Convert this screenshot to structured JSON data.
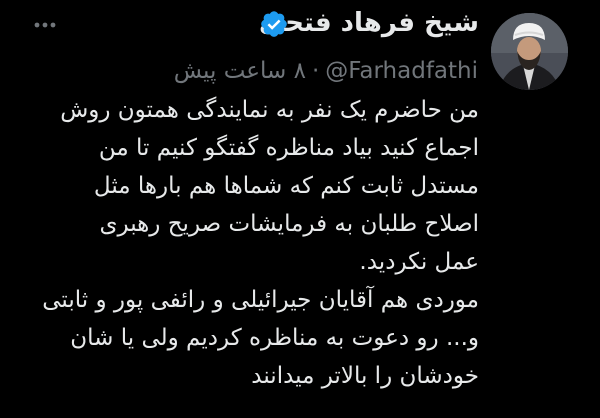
{
  "tweet": {
    "author": {
      "name": "شیخ فرهاد فتحی",
      "handle": "@Farhadfathi",
      "verified": true
    },
    "separator": "·",
    "timestamp": "۸ ساعت پیش",
    "text_lines": [
      "من حاضرم یک نفر به نمایندگی همتون روش",
      "اجماع کنید بیاد مناظره گفتگو کنیم تا من",
      "مستدل ثابت کنم که شماها هم بارها مثل",
      "اصلاح طلبان به فرمایشات صریح رهبری",
      "عمل نکردید.",
      "موردی هم آقایان جیرائیلی و رائفی پور و ثابتی",
      "و... رو دعوت به مناظره کردیم ولی یا شان",
      "خودشان را بالاتر میدانند"
    ],
    "icons": {
      "verified": "verified-badge-icon",
      "more": "more-options-icon",
      "avatar": "profile-avatar"
    }
  },
  "colors": {
    "background": "#000000",
    "primary_text": "#e7e9ea",
    "secondary_text": "#71767b",
    "verified_badge": "#1d9bf0"
  }
}
